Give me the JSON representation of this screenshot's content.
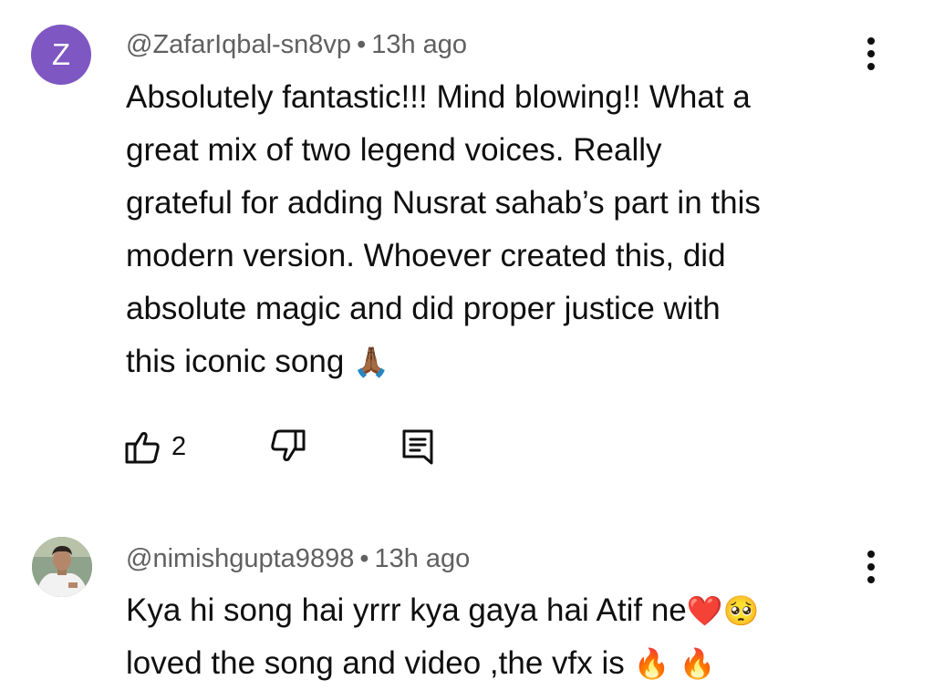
{
  "comments": [
    {
      "avatar_letter": "Z",
      "avatar_color": "#7e57c2",
      "author": "@ZafarIqbal-sn8vp",
      "separator": "•",
      "time": "13h ago",
      "lines": [
        "Absolutely fantastic!!! Mind blowing!! What a",
        "great mix of two legend voices. Really",
        "grateful for adding Nusrat sahab’s part in this",
        "modern version. Whoever created this, did",
        "absolute magic and did proper justice with",
        "this iconic song"
      ],
      "line_6_emoji": "🙏🏾",
      "like_count": "2",
      "icons": {
        "like": "thumbs-up-icon",
        "dislike": "thumbs-down-icon",
        "reply": "reply-comment-icon",
        "more": "more-vertical-icon"
      }
    },
    {
      "author": "@nimishgupta9898",
      "separator": "•",
      "time": "13h ago",
      "line_1": "Kya hi song hai yrrr kya gaya hai Atif ne",
      "line_1_emoji": "❤️🥺",
      "line_2": "loved the song and video ,the vfx is ",
      "line_2_emoji": "🔥 🔥"
    }
  ],
  "colors": {
    "text_primary": "#0f0f0f",
    "text_secondary": "#606060",
    "background": "#ffffff"
  }
}
